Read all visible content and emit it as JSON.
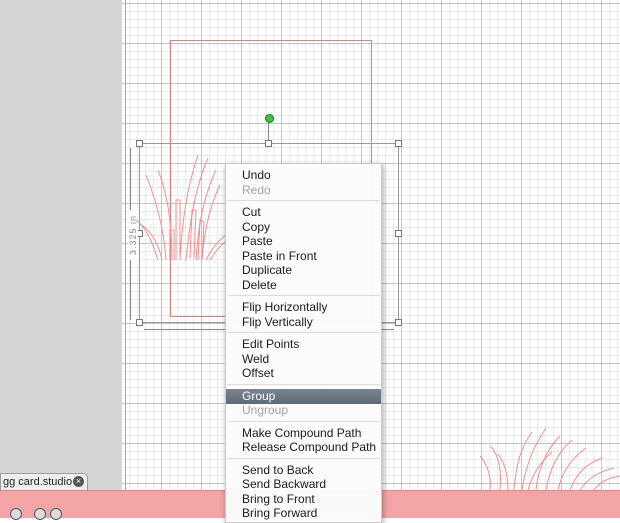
{
  "document": {
    "tab_label": "gg card.studio",
    "close_glyph": "×"
  },
  "dimensions": {
    "height_label": "3.325 in"
  },
  "context_menu": {
    "groups": [
      [
        {
          "label": "Undo",
          "enabled": true
        },
        {
          "label": "Redo",
          "enabled": false
        }
      ],
      [
        {
          "label": "Cut",
          "enabled": true
        },
        {
          "label": "Copy",
          "enabled": true
        },
        {
          "label": "Paste",
          "enabled": true
        },
        {
          "label": "Paste in Front",
          "enabled": true
        },
        {
          "label": "Duplicate",
          "enabled": true
        },
        {
          "label": "Delete",
          "enabled": true
        }
      ],
      [
        {
          "label": "Flip Horizontally",
          "enabled": true
        },
        {
          "label": "Flip Vertically",
          "enabled": true
        }
      ],
      [
        {
          "label": "Edit Points",
          "enabled": true
        },
        {
          "label": "Weld",
          "enabled": true
        },
        {
          "label": "Offset",
          "enabled": true
        }
      ],
      [
        {
          "label": "Group",
          "enabled": true,
          "highlighted": true
        },
        {
          "label": "Ungroup",
          "enabled": false
        }
      ],
      [
        {
          "label": "Make Compound Path",
          "enabled": true
        },
        {
          "label": "Release Compound Path",
          "enabled": true
        }
      ],
      [
        {
          "label": "Send to Back",
          "enabled": true
        },
        {
          "label": "Send Backward",
          "enabled": true
        },
        {
          "label": "Bring to Front",
          "enabled": true
        },
        {
          "label": "Bring Forward",
          "enabled": true
        }
      ]
    ]
  },
  "colors": {
    "cut_line": "#e88d8d",
    "grass": "#f08f8f",
    "highlight": "#6a737d",
    "bottom_bar": "#f4a6a6",
    "rotate_handle": "#38c63b"
  },
  "icons": {
    "rotate_handle": "rotate-handle-icon",
    "tab_close": "close-icon"
  }
}
